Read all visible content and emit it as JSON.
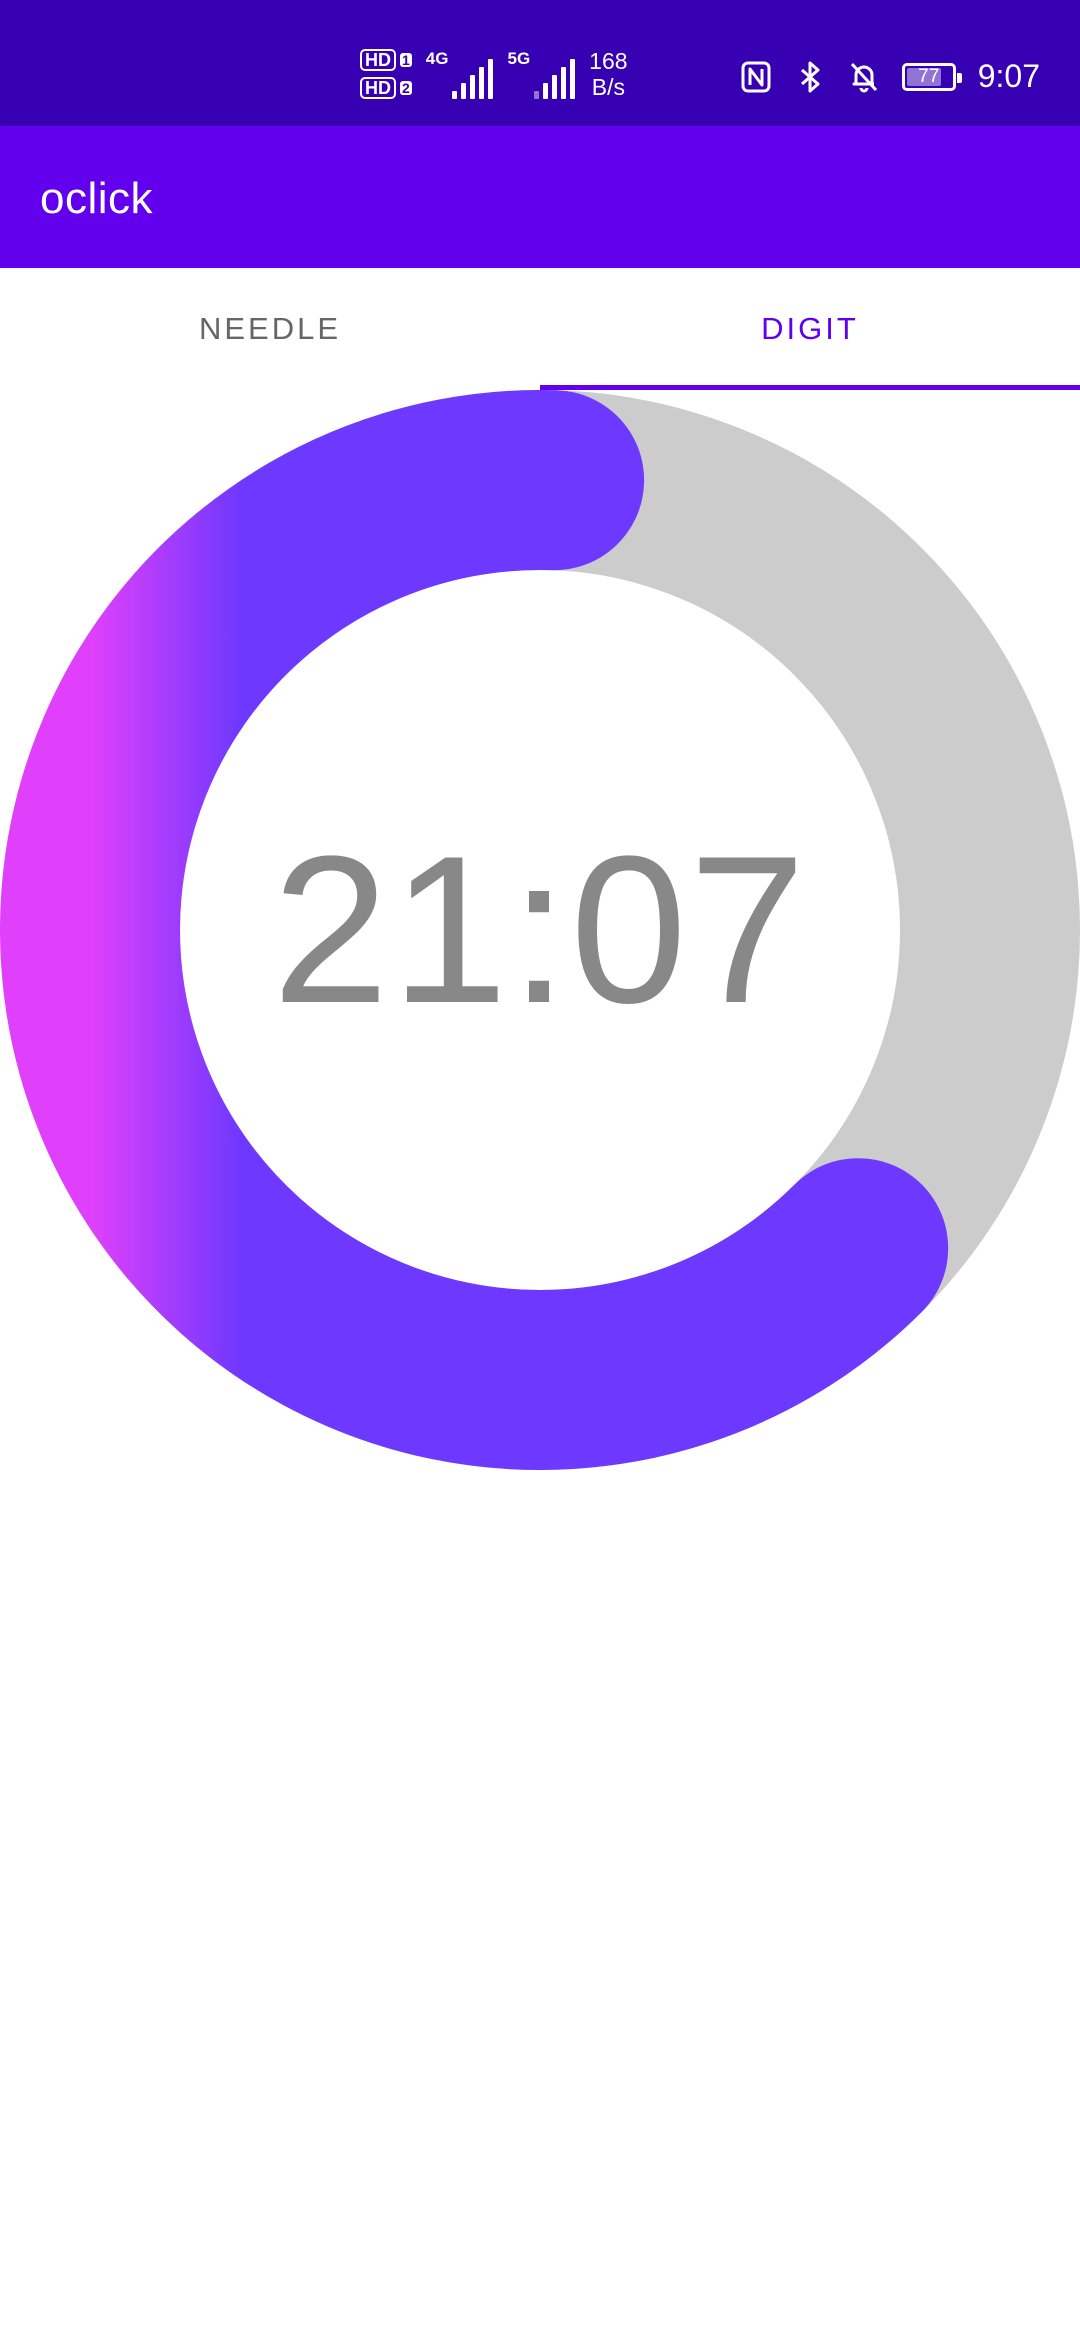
{
  "status_bar": {
    "sim1_label": "HD",
    "sim1_index": "1",
    "sim2_label": "HD",
    "sim2_index": "2",
    "network1": "4G",
    "network2": "5G",
    "speed_value": "168",
    "speed_unit": "B/s",
    "icons": [
      "nfc-icon",
      "bluetooth-icon",
      "bell-off-icon"
    ],
    "battery_level": "77",
    "time": "9:07"
  },
  "app_bar": {
    "title": "oclick",
    "color": "#6200ee"
  },
  "tabs": [
    {
      "label": "NEEDLE",
      "selected": false
    },
    {
      "label": "DIGIT",
      "selected": true
    }
  ],
  "clock": {
    "time": "21:07",
    "progress_fraction": 0.63,
    "track_color": "#cccccc",
    "gradient_start": "#e040fb",
    "gradient_end": "#6d38ff",
    "text_color": "#888888"
  }
}
